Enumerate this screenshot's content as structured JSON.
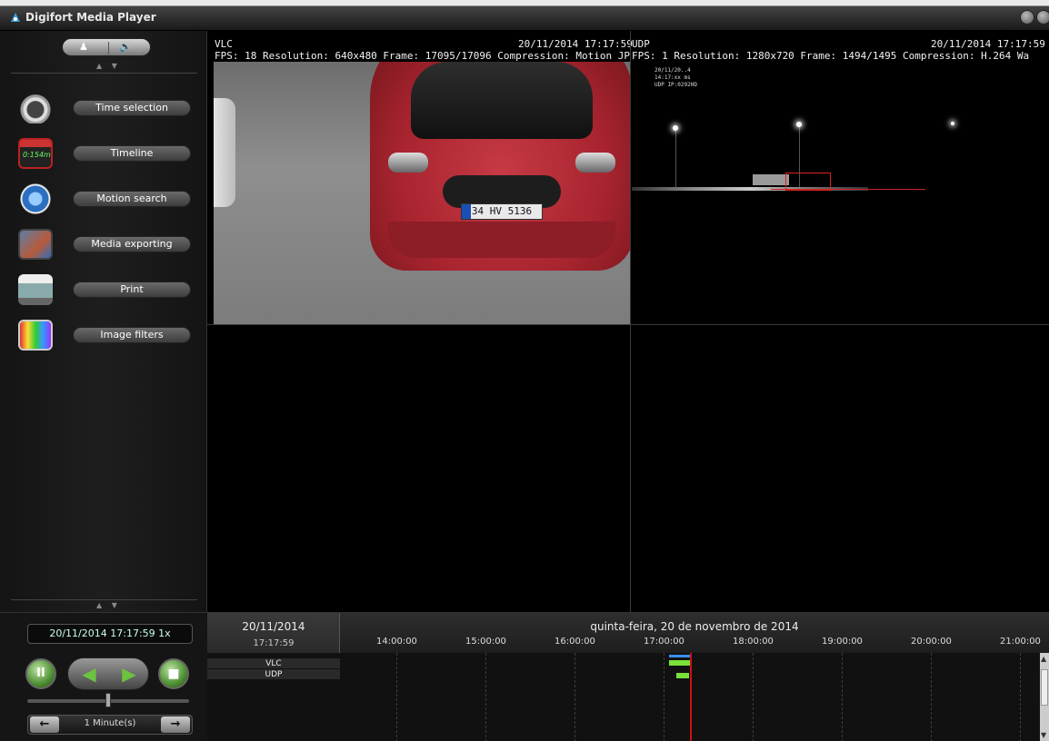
{
  "window": {
    "title": "Digifort Media Player"
  },
  "sidebar": {
    "audio_icon": "🔊",
    "user_icon": "♟",
    "arrows": "▲ ▼",
    "items": [
      {
        "label": "Time selection",
        "icon": "stopwatch-icon"
      },
      {
        "label": "Timeline",
        "icon": "timeline-icon",
        "icon_text": "0:154m"
      },
      {
        "label": "Motion search",
        "icon": "motion-search-icon"
      },
      {
        "label": "Media exporting",
        "icon": "film-export-icon"
      },
      {
        "label": "Print",
        "icon": "printer-icon"
      },
      {
        "label": "Image filters",
        "icon": "image-filters-icon"
      }
    ]
  },
  "controls": {
    "time_display": "20/11/2014 17:17:59 1x",
    "pause_glyph": "II",
    "rewind_glyph": "◀",
    "play_glyph": "▶",
    "stop_glyph": "■",
    "step_left_glyph": "←",
    "step_right_glyph": "→",
    "step_label": "1 Minute(s)",
    "speed_position": 0.5
  },
  "cameras": [
    {
      "name": "VLC",
      "timestamp": "20/11/2014 17:17:59",
      "info": "FPS: 18   Resolution: 640x480   Frame: 17095/17096   Compression: Motion JP",
      "plate": "34 HV 5136"
    },
    {
      "name": "UDP",
      "timestamp": "20/11/2014 17:17:59",
      "info": "FPS: 1   Resolution: 1280x720   Frame: 1494/1495   Compression: H.264   Wa",
      "overlay_lines": [
        "20/11/20..4",
        "14:17:xx ms",
        "UDP IP:0292HD"
      ]
    }
  ],
  "timeline": {
    "date": "20/11/2014",
    "time": "17:17:59",
    "day_label": "quinta-feira, 20 de novembro de 2014",
    "ticks": [
      "14:00:00",
      "15:00:00",
      "16:00:00",
      "17:00:00",
      "18:00:00",
      "19:00:00",
      "20:00:00",
      "21:00:00"
    ],
    "rows": [
      "VLC",
      "UDP"
    ],
    "colors": {
      "recording": "#7ae03a",
      "cursor": "#cc1111",
      "motion": "#3a8ef0"
    }
  }
}
